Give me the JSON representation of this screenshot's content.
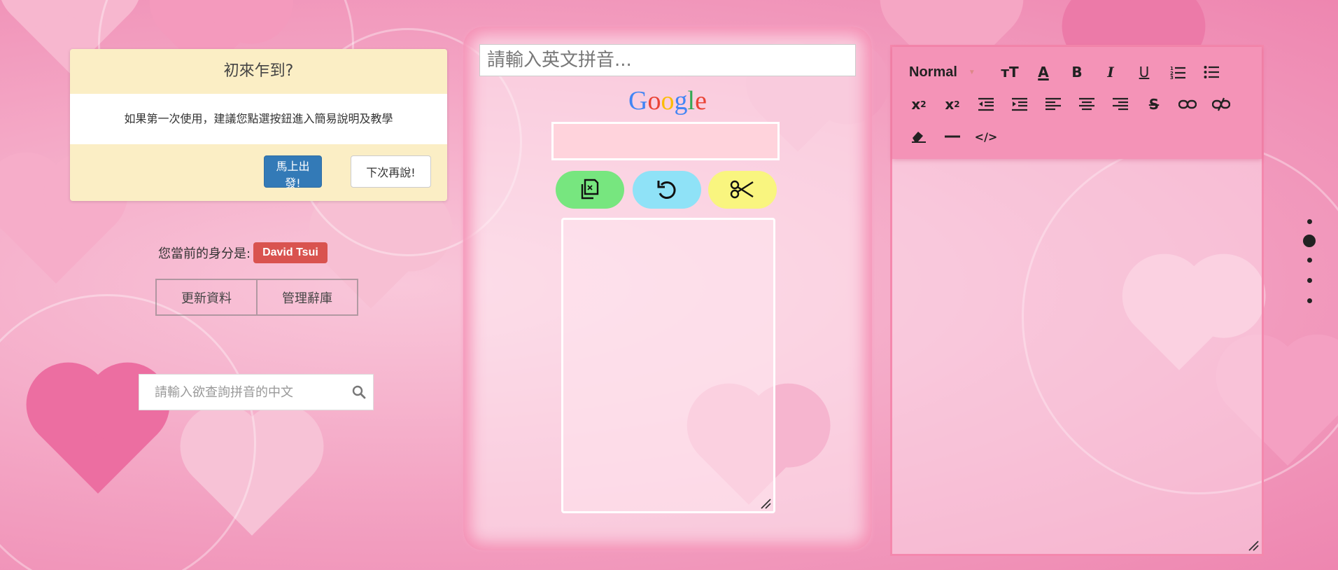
{
  "welcome": {
    "title": "初來乍到?",
    "message": "如果第一次使用，建議您點選按鈕進入簡易說明及教學",
    "go_label": "馬上出發!",
    "later_label": "下次再說!"
  },
  "identity": {
    "label": "您當前的身分是:",
    "user": "David Tsui"
  },
  "actions": {
    "update_label": "更新資料",
    "manage_label": "管理辭庫"
  },
  "lookup": {
    "placeholder": "請輸入欲查詢拼音的中文"
  },
  "converter": {
    "placeholder": "請輸入英文拼音...",
    "provider": "Google",
    "tools": [
      "copy-icon",
      "undo-icon",
      "cut-icon"
    ]
  },
  "editor": {
    "style_select": "Normal",
    "row1": [
      "font-size-icon",
      "font-color-icon",
      "bold-icon",
      "italic-icon",
      "underline-icon",
      "ordered-list-icon",
      "bullet-list-icon"
    ],
    "row2": [
      "subscript-icon",
      "superscript-icon",
      "outdent-icon",
      "indent-icon",
      "align-left-icon",
      "align-center-icon",
      "align-right-icon",
      "strikethrough-icon",
      "link-icon",
      "unlink-icon"
    ],
    "row3": [
      "clear-format-icon",
      "horizontal-rule-icon",
      "code-view-icon"
    ]
  },
  "colors": {
    "primary": "#337ab7",
    "danger": "#d9534f",
    "welcome_bg": "#fbeec5",
    "copy": "#77e67f",
    "undo": "#8fe2f7",
    "cut": "#f9f57f",
    "toolbar": "#f493b7"
  }
}
